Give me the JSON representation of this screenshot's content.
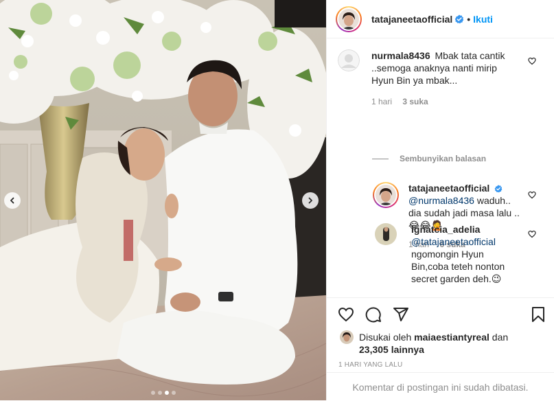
{
  "post": {
    "author": "tatajaneetaofficial",
    "follow_separator": "•",
    "follow_label": "Ikuti",
    "carousel": {
      "total_slides": 4,
      "active_slide": 3
    }
  },
  "comments": [
    {
      "user": "nurmala8436",
      "text": "Mbak tata cantik ..semoga anaknya nanti mirip Hyun Bin ya mbak...",
      "time": "1 hari",
      "likes": "3 suka"
    }
  ],
  "hide_replies_label": "Sembunyikan balasan",
  "replies": [
    {
      "user": "tatajaneetaofficial",
      "mention": "@nurmala8436",
      "text": " waduh.. dia sudah jadi masa lalu .. 😂😂🤦",
      "time": "1 hari",
      "likes": "6 suka"
    },
    {
      "user": "ignatcia_adelia",
      "mention": "@tatajaneetaofficial",
      "text": "ngomongin Hyun Bin,coba teteh nonton secret garden deh.😉"
    }
  ],
  "likes": {
    "prefix": "Disukai oleh ",
    "user": "maiaestiantyreal",
    "middle": " dan",
    "count": "23,305 lainnya"
  },
  "timestamp": "1 HARI YANG LALU",
  "comments_closed": "Komentar di postingan ini sudah dibatasi.",
  "icons": [
    "verified-badge-icon",
    "heart-icon",
    "comment-icon",
    "share-icon",
    "bookmark-icon",
    "chevron-left-icon",
    "chevron-right-icon"
  ],
  "colors": {
    "link": "#0095f6",
    "mention": "#00376b",
    "muted": "#8e8e8e",
    "verified": "#3897f0"
  }
}
